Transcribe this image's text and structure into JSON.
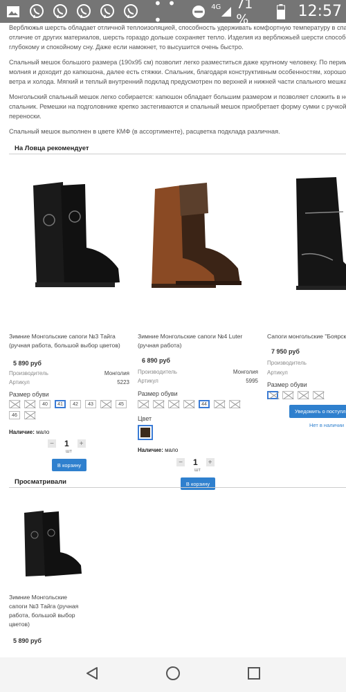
{
  "status_bar": {
    "icons": [
      "image-icon",
      "viber-icon",
      "viber-icon",
      "viber-icon",
      "viber-icon",
      "viber-icon"
    ],
    "dots": "• • •",
    "network": "4G",
    "battery_percent": "71 %",
    "time": "12:57"
  },
  "description": {
    "paragraphs": [
      "Верблюжья шерсть обладает отличной теплоизоляцией, способность удерживать комфортную температуру в спаль",
      "отличие от других материалов, шерсть гораздо дольше сохраняет тепло. Изделия из верблюжьей шерсти способств",
      "глубокому и спокойному сну. Даже если намокнет, то высушится очень быстро.",
      "Спальный мешок большого размера (190х95 см) позволит легко разместиться даже крупному человеку. По периме",
      "молния и доходит до капюшона, далее есть стяжки. Спальник, благодаря конструктивным особенностям, хорошо за",
      "ветра и холода. Мягкий и теплый внутренний подклад предусмотрен по верхней и нижней части спального мешка.",
      "Монгольский спальный мешок легко собирается: капюшон обладает большим размером и позволяет сложить в нег",
      "спальник. Ремешки на подголовнике крепко застегиваются и спальный мешок приобретает форму сумки с ручкой д",
      "переноски.",
      "Спальный мешок выполнен в цвете КМФ (в ассортименте), расцветка подклада различная."
    ]
  },
  "recommend": {
    "title": "На Ловца рекомендует",
    "products": [
      {
        "name_line1": "Зимние Монгольские сапоги №3 Тайга",
        "name_line2": "(ручная работа, большой выбор цветов)",
        "price": "5 890 руб",
        "maker_label": "Производитель",
        "maker": "Монголия",
        "sku_label": "Артикул",
        "sku": "5223",
        "size_label": "Размер обуви",
        "sizes": [
          {
            "v": "",
            "na": true
          },
          {
            "v": "",
            "na": true
          },
          {
            "v": "40"
          },
          {
            "v": "41",
            "sel": true
          },
          {
            "v": "42"
          },
          {
            "v": "43"
          },
          {
            "v": "",
            "na": true
          },
          {
            "v": "45"
          },
          {
            "v": "46"
          },
          {
            "v": "",
            "na": true
          }
        ],
        "stock_label": "Наличие:",
        "stock": "мало",
        "qty": "1",
        "unit": "шт",
        "cart": "В корзину"
      },
      {
        "name_line1": "Зимние Монгольские сапоги №4 Luter",
        "name_line2": "(ручная работа)",
        "price": "6 890 руб",
        "maker_label": "Производитель",
        "maker": "Монголия",
        "sku_label": "Артикул",
        "sku": "5995",
        "size_label": "Размер обуви",
        "sizes": [
          {
            "v": "",
            "na": true
          },
          {
            "v": "",
            "na": true
          },
          {
            "v": "",
            "na": true
          },
          {
            "v": "",
            "na": true
          },
          {
            "v": "44",
            "sel": true
          },
          {
            "v": "",
            "na": true
          },
          {
            "v": "",
            "na": true
          }
        ],
        "color_label": "Цвет",
        "color": "#3b2a1c",
        "stock_label": "Наличие:",
        "stock": "мало",
        "qty": "1",
        "unit": "шт",
        "cart": "В корзину"
      },
      {
        "name_line1": "Сапоги монгольские \"Боярск",
        "price": "7 950 руб",
        "maker_label": "Производитель",
        "sku_label": "Артикул",
        "size_label": "Размер обуви",
        "notify": "Уведомить о поступл",
        "no_stock": "Нет в наличии"
      }
    ]
  },
  "viewed": {
    "title": "Просматривали",
    "product": {
      "name_lines": [
        "Зимние Монгольские",
        "сапоги №3 Тайга (ручная",
        "работа, большой выбор",
        "цветов)"
      ],
      "price": "5 890 руб"
    }
  },
  "colors": {
    "accent": "#2f80ce",
    "selected_border": "#3a7bd5",
    "status_bar": "#757575"
  }
}
